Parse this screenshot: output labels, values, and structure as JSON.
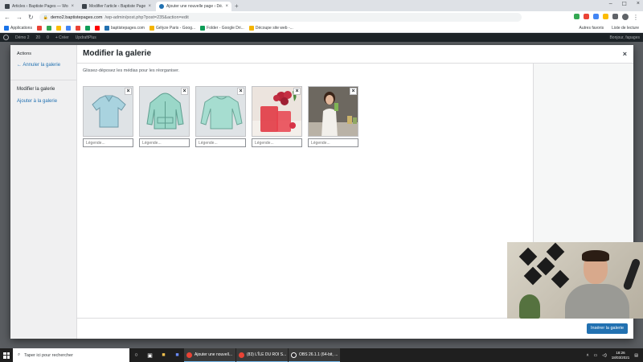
{
  "browser": {
    "tabs": [
      {
        "title": "Articles ‹ Baptiste Pages — Wor...",
        "active": false
      },
      {
        "title": "Modifier l'article ‹ Baptiste Page...",
        "active": false
      },
      {
        "title": "Ajouter une nouvelle page ‹ Dé...",
        "active": true
      }
    ],
    "new_tab": "+",
    "url_host": "demo2.baptistepages.com",
    "url_path": "/wp-admin/post.php?post=235&action=edit",
    "bookmarks": [
      {
        "label": "Applications",
        "color": "#1a73e8"
      },
      {
        "label": "",
        "color": "#ea4335"
      },
      {
        "label": "",
        "color": "#34a853"
      },
      {
        "label": "",
        "color": "#fbbc04"
      },
      {
        "label": "",
        "color": "#4285f4"
      },
      {
        "label": "",
        "color": "#ea4335"
      },
      {
        "label": "",
        "color": "#0f9d58"
      },
      {
        "label": "",
        "color": "#ff0000"
      },
      {
        "label": "baptistepages.com",
        "color": "#2271b1"
      },
      {
        "label": "Gélyze Paris - Goog...",
        "color": "#f4b400"
      },
      {
        "label": "Folder - Google Dri...",
        "color": "#0f9d58"
      },
      {
        "label": "Découpe site web -...",
        "color": "#f4b400"
      }
    ],
    "bookmarks_right": [
      "Autres favoris",
      "Liste de lecture"
    ]
  },
  "wp_admin_bar": {
    "items": [
      "Démo 2",
      "20",
      "0",
      "+ Créer",
      "UpdraftPlus"
    ],
    "right": "Bonjour, fapages"
  },
  "modal": {
    "menu": {
      "heading": "Actions",
      "cancel_link": "← Annuler la galerie",
      "active_item": "Modifier la galerie",
      "add_link": "Ajouter à la galerie"
    },
    "title": "Modifier la galerie",
    "close": "×",
    "instructions": "Glissez-déposez les médias pour les réorganiser.",
    "caption_placeholder": "Légende...",
    "remove_label": "×",
    "images": [
      {
        "name": "polo-shirt",
        "kind": "polo",
        "bg": "#dfe3e6"
      },
      {
        "name": "hoodie",
        "kind": "hoodie",
        "bg": "#dfe3e6"
      },
      {
        "name": "sweater",
        "kind": "sweater",
        "bg": "#dfe3e6"
      },
      {
        "name": "strawberry-drink",
        "kind": "drink",
        "bg": "#e7dcd6"
      },
      {
        "name": "woman-drinking",
        "kind": "woman",
        "bg": "#5a5550"
      }
    ],
    "insert_button": "Insérer la galerie"
  },
  "taskbar": {
    "search_placeholder": "Taper ici pour rechercher",
    "apps": [
      {
        "label": "Ajouter une nouvell...",
        "color": "#ea4335"
      },
      {
        "label": "(83) L'ÎLE DU ROI S...",
        "color": "#ea4335"
      },
      {
        "label": "OBS 26.1.1 (64-bit, ...",
        "color": "#302e31"
      }
    ],
    "time": "18:26",
    "date": "18/03/2021"
  },
  "colors": {
    "wp_blue": "#2271b1",
    "admin_bar": "#1d2327"
  }
}
